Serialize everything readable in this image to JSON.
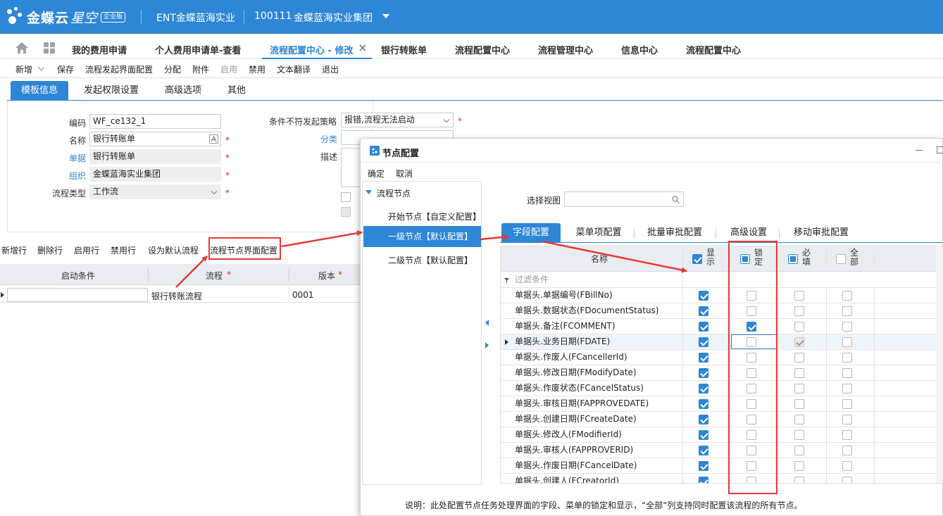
{
  "app": {
    "logo_brand": "金蝶云",
    "logo_product": "星空",
    "logo_badge": "企业版",
    "tenant": "ENT金蝶蓝海实业",
    "org_code": "100111",
    "org_name": "金蝶蓝海实业集团"
  },
  "tabs": [
    {
      "label": "我的费用申请"
    },
    {
      "label": "个人费用申请单-查看"
    },
    {
      "label": "流程配置中心 - 修改"
    },
    {
      "label": "银行转账单"
    },
    {
      "label": "流程配置中心"
    },
    {
      "label": "流程管理中心"
    },
    {
      "label": "信息中心"
    },
    {
      "label": "流程配置中心"
    }
  ],
  "toolbar": [
    "新增",
    "保存",
    "流程发起界面配置",
    "分配",
    "附件",
    "启用",
    "禁用",
    "文本翻译",
    "退出"
  ],
  "subtabs": [
    "模板信息",
    "发起权限设置",
    "高级选项",
    "其他"
  ],
  "form": {
    "code_label": "编码",
    "code_value": "WF_ce132_1",
    "name_label": "名称",
    "name_value": "银行转账单",
    "bill_label": "单据",
    "bill_value": "银行转账单",
    "org_label": "组织",
    "org_value": "金蝶蓝海实业集团",
    "flowtype_label": "流程类型",
    "flowtype_value": "工作流",
    "policy_label": "条件不符发起策略",
    "policy_value": "报错,流程无法启动",
    "category_label": "分类",
    "desc_label": "描述",
    "req_mark": "*"
  },
  "grid_toolbar": [
    "新增行",
    "删除行",
    "启用行",
    "禁用行",
    "设为默认流程",
    "流程节点界面配置"
  ],
  "grid": {
    "headers": [
      "启动条件",
      "流程",
      "版本"
    ],
    "row": {
      "condition": "",
      "flow": "银行转账流程",
      "version": "0001"
    }
  },
  "dialog": {
    "title": "节点配置",
    "menu": [
      "确定",
      "取消"
    ],
    "tree_root": "流程节点",
    "tree_nodes": [
      "开始节点【自定义配置】",
      "一级节点【默认配置】",
      "二级节点【默认配置】"
    ],
    "view_label": "选择视图",
    "field_tabs": [
      "字段配置",
      "菜单项配置",
      "批量审批配置",
      "高级设置",
      "移动审批配置"
    ],
    "grid_headers": {
      "name": "名称",
      "show": "显示",
      "lock": "锁定",
      "required": "必填",
      "all": "全部"
    },
    "filter_label": "过滤条件",
    "fields": [
      {
        "name": "单据头.单据编号(FBillNo)",
        "show": true,
        "lock": false,
        "required": false,
        "all": false
      },
      {
        "name": "单据头.数据状态(FDocumentStatus)",
        "show": true,
        "lock": false,
        "required": false,
        "all": false
      },
      {
        "name": "单据头.备注(FCOMMENT)",
        "show": true,
        "lock": true,
        "required": false,
        "all": false
      },
      {
        "name": "单据头.业务日期(FDATE)",
        "show": true,
        "lock": false,
        "required": true,
        "all": false
      },
      {
        "name": "单据头.作废人(FCancellerId)",
        "show": true,
        "lock": false,
        "required": false,
        "all": false
      },
      {
        "name": "单据头.修改日期(FModifyDate)",
        "show": true,
        "lock": false,
        "required": false,
        "all": false
      },
      {
        "name": "单据头.作废状态(FCancelStatus)",
        "show": true,
        "lock": false,
        "required": false,
        "all": false
      },
      {
        "name": "单据头.审核日期(FAPPROVEDATE)",
        "show": true,
        "lock": false,
        "required": false,
        "all": false
      },
      {
        "name": "单据头.创建日期(FCreateDate)",
        "show": true,
        "lock": false,
        "required": false,
        "all": false
      },
      {
        "name": "单据头.修改人(FModifierId)",
        "show": true,
        "lock": false,
        "required": false,
        "all": false
      },
      {
        "name": "单据头.审核人(FAPPROVERID)",
        "show": true,
        "lock": false,
        "required": false,
        "all": false
      },
      {
        "name": "单据头.作废日期(FCancelDate)",
        "show": true,
        "lock": false,
        "required": false,
        "all": false
      },
      {
        "name": "单据头.创建人(FCreatorId)",
        "show": true,
        "lock": false,
        "required": false,
        "all": false
      }
    ],
    "note": "说明：此处配置节点任务处理界面的字段、菜单的锁定和显示，“全部“列支持同时配置该流程的所有节点。"
  },
  "colors": {
    "primary": "#2e86d6",
    "annotation_red": "#e53935"
  }
}
